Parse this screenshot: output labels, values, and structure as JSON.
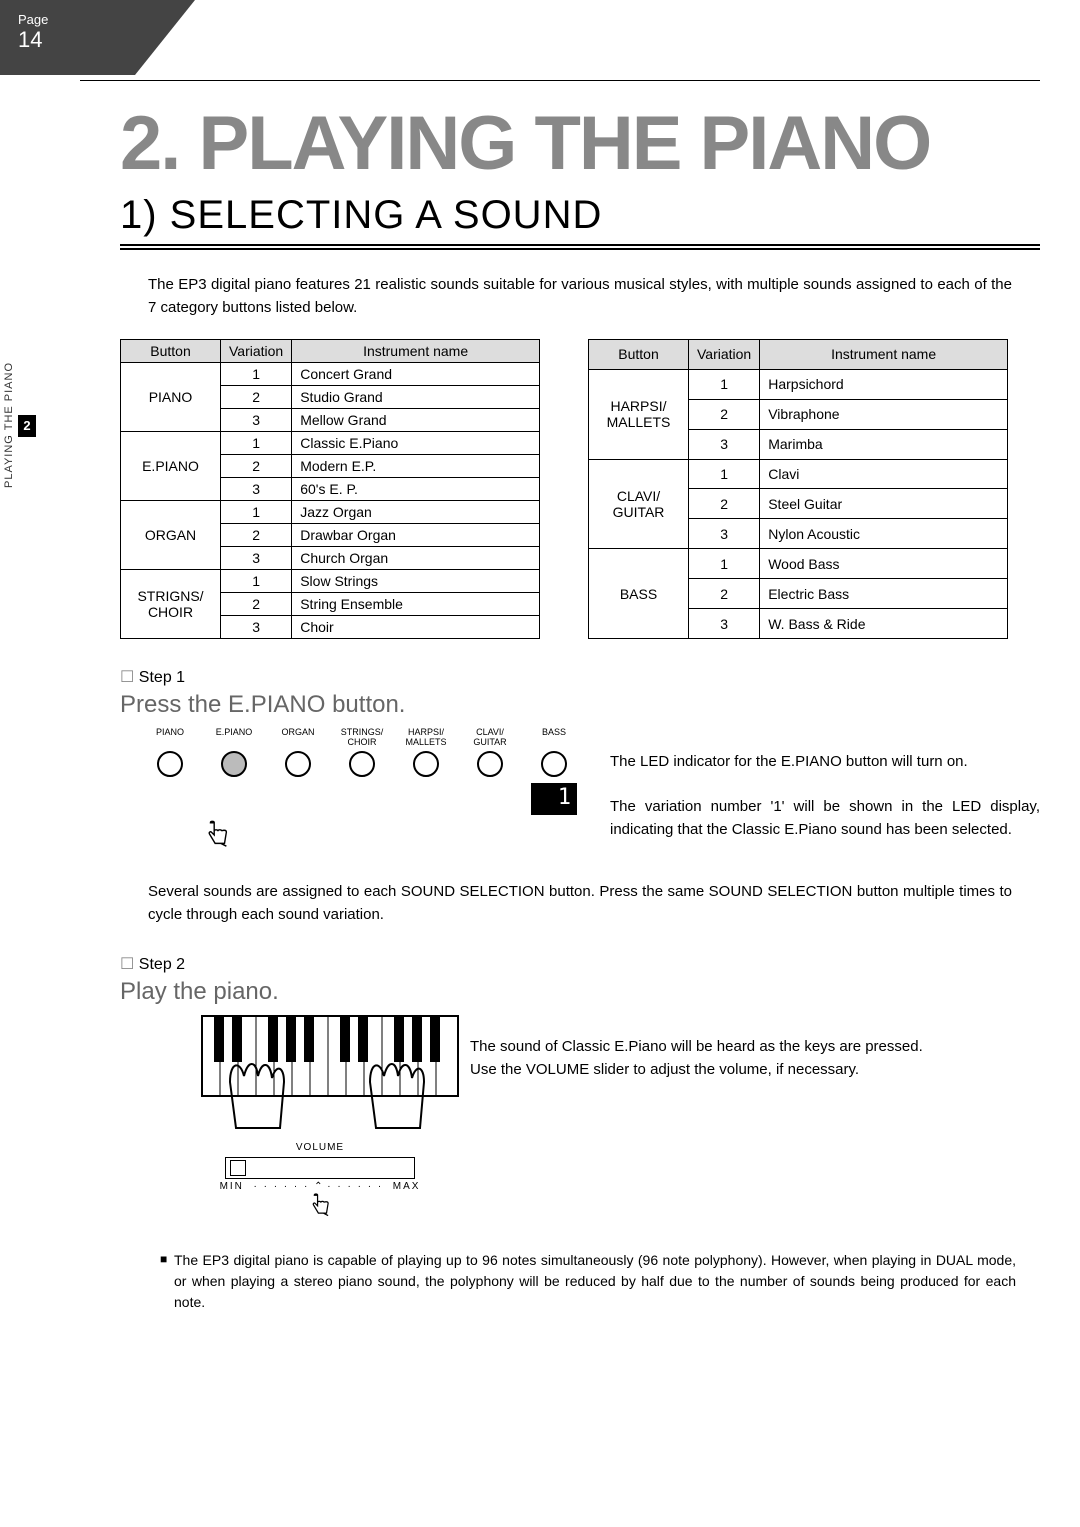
{
  "page": {
    "label": "Page",
    "number": "14"
  },
  "side_tab": {
    "text": "PLAYING THE PIANO",
    "num": "2"
  },
  "chapter": "2. PLAYING THE PIANO",
  "section": "1) SELECTING A SOUND",
  "intro": "The EP3 digital piano features 21 realistic sounds suitable for various musical styles, with multiple sounds assigned to each of the 7 category buttons listed below.",
  "table_headers": {
    "button": "Button",
    "variation": "Variation",
    "instrument": "Instrument name"
  },
  "tables": [
    [
      {
        "button": "PIANO",
        "rows": [
          [
            "1",
            "Concert Grand"
          ],
          [
            "2",
            "Studio Grand"
          ],
          [
            "3",
            "Mellow Grand"
          ]
        ]
      },
      {
        "button": "E.PIANO",
        "rows": [
          [
            "1",
            "Classic E.Piano"
          ],
          [
            "2",
            "Modern E.P."
          ],
          [
            "3",
            "60's E. P."
          ]
        ]
      },
      {
        "button": "ORGAN",
        "rows": [
          [
            "1",
            "Jazz Organ"
          ],
          [
            "2",
            "Drawbar Organ"
          ],
          [
            "3",
            "Church Organ"
          ]
        ]
      },
      {
        "button": "STRIGNS/\nCHOIR",
        "rows": [
          [
            "1",
            "Slow Strings"
          ],
          [
            "2",
            "String Ensemble"
          ],
          [
            "3",
            "Choir"
          ]
        ]
      }
    ],
    [
      {
        "button": "HARPSI/\nMALLETS",
        "rows": [
          [
            "1",
            "Harpsichord"
          ],
          [
            "2",
            "Vibraphone"
          ],
          [
            "3",
            "Marimba"
          ]
        ]
      },
      {
        "button": "CLAVI/\nGUITAR",
        "rows": [
          [
            "1",
            "Clavi"
          ],
          [
            "2",
            "Steel Guitar"
          ],
          [
            "3",
            "Nylon Acoustic"
          ]
        ]
      },
      {
        "button": "BASS",
        "rows": [
          [
            "1",
            "Wood Bass"
          ],
          [
            "2",
            "Electric Bass"
          ],
          [
            "3",
            "W. Bass & Ride"
          ]
        ]
      }
    ]
  ],
  "step1": {
    "label": "Step 1",
    "action": "Press the E.PIANO button.",
    "buttons": [
      "PIANO",
      "E.PIANO",
      "ORGAN",
      "STRINGS/\nCHOIR",
      "HARPSI/\nMALLETS",
      "CLAVI/\nGUITAR",
      "BASS"
    ],
    "led": "1",
    "text1": "The LED indicator for the E.PIANO button will turn on.",
    "text2": "The variation number '1' will be shown in the LED display, indicating that the Classic E.Piano sound has been selected."
  },
  "midtext": "Several sounds are assigned to each SOUND SELECTION button.  Press the same SOUND SELECTION button multiple times to cycle through each sound variation.",
  "step2": {
    "label": "Step 2",
    "action": "Play the piano.",
    "volume_label": "VOLUME",
    "min": "MIN",
    "max": "MAX",
    "text1": "The sound of Classic E.Piano will be heard as the keys are pressed.",
    "text2": "Use the VOLUME slider to adjust the volume, if necessary."
  },
  "footnote": "The EP3 digital piano is capable of playing up to 96 notes simultaneously (96 note polyphony). However, when playing in DUAL mode, or when playing a stereo piano sound, the polyphony will be reduced by half due to the number of sounds being produced for each note."
}
